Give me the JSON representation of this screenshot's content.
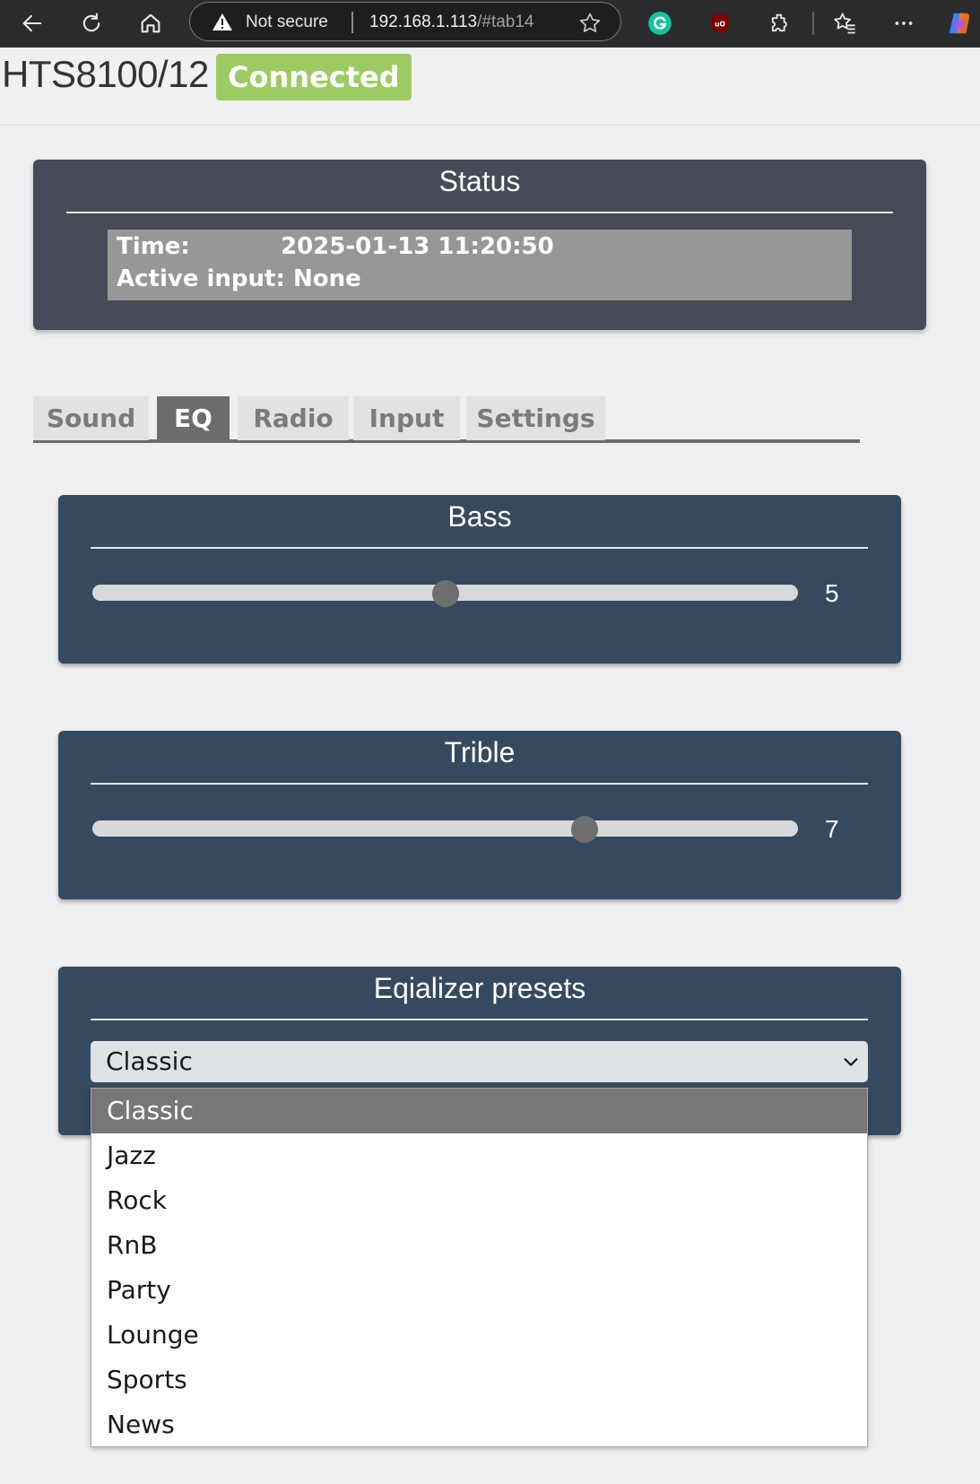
{
  "browser": {
    "security_label": "Not secure",
    "url_host": "192.168.1.113",
    "url_path": "/#tab14",
    "icons": [
      "back-arrow-icon",
      "refresh-icon",
      "home-icon",
      "warning-icon",
      "favorite-star-icon",
      "grammarly-icon",
      "ublock-icon",
      "extensions-icon",
      "favorites-icon",
      "more-icon",
      "copilot-icon"
    ]
  },
  "header": {
    "title": "HTS8100/12",
    "connection_status": "Connected",
    "status_color": "#9ccb64"
  },
  "status": {
    "title": "Status",
    "time_label": "Time:",
    "time_value": "2025-01-13 11:20:50",
    "input_label": "Active input:",
    "input_value": "None"
  },
  "tabs": [
    {
      "label": "Sound",
      "active": false
    },
    {
      "label": "EQ",
      "active": true
    },
    {
      "label": "Radio",
      "active": false
    },
    {
      "label": "Input",
      "active": false
    },
    {
      "label": "Settings",
      "active": false
    }
  ],
  "bass": {
    "title": "Bass",
    "value": "5",
    "level": 0.5
  },
  "trible": {
    "title": "Trible",
    "value": "7",
    "level": 0.7
  },
  "presets": {
    "title": "Eqializer presets",
    "selected": "Classic",
    "options": [
      "Classic",
      "Jazz",
      "Rock",
      "RnB",
      "Party",
      "Lounge",
      "Sports",
      "News"
    ]
  },
  "colors": {
    "status_panel": "#484a57",
    "eq_panel": "#364a5f",
    "active_tab": "#6c6c6c"
  }
}
